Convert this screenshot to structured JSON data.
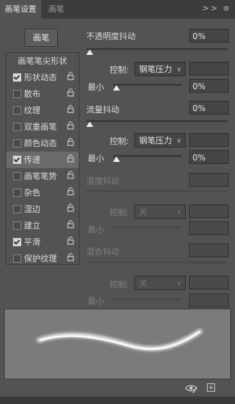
{
  "tabs": {
    "active": "画笔设置",
    "inactive": "画笔",
    "close_glyph": "×",
    "menu_glyph": ">> ≡"
  },
  "left": {
    "preset_button": "画笔",
    "header": "画笔笔尖形状",
    "items": [
      {
        "label": "形状动态",
        "checked": true
      },
      {
        "label": "散布",
        "checked": false
      },
      {
        "label": "纹理",
        "checked": false
      },
      {
        "label": "双重画笔",
        "checked": false
      },
      {
        "label": "颜色动态",
        "checked": false
      },
      {
        "label": "传递",
        "checked": true,
        "selected": true
      },
      {
        "label": "画笔笔势",
        "checked": false
      },
      {
        "label": "杂色",
        "checked": false
      },
      {
        "label": "湿边",
        "checked": false
      },
      {
        "label": "建立",
        "checked": false
      },
      {
        "label": "平滑",
        "checked": true
      },
      {
        "label": "保护纹理",
        "checked": false
      }
    ]
  },
  "right": {
    "opacity_jitter": {
      "label": "不透明度抖动",
      "value": "0%",
      "level": 0
    },
    "control1": {
      "label": "控制:",
      "value": "钢笔压力"
    },
    "min1": {
      "label": "最小",
      "value": "0%",
      "level": 0
    },
    "flow_jitter": {
      "label": "流量抖动",
      "value": "0%",
      "level": 0
    },
    "control2": {
      "label": "控制:",
      "value": "钢笔压力"
    },
    "min2": {
      "label": "最小",
      "value": "0%",
      "level": 0
    },
    "wetness_jitter": {
      "label": "湿度抖动"
    },
    "control3": {
      "label": "控制:",
      "value": "关"
    },
    "min3": {
      "label": "最小"
    },
    "mix_jitter": {
      "label": "混合抖动"
    },
    "control4": {
      "label": "控制:",
      "value": "关"
    },
    "min4": {
      "label": "最小"
    }
  },
  "icons": {
    "lock": "lock-icon",
    "eye": "eye-slash-icon",
    "new": "new-preset-icon"
  }
}
